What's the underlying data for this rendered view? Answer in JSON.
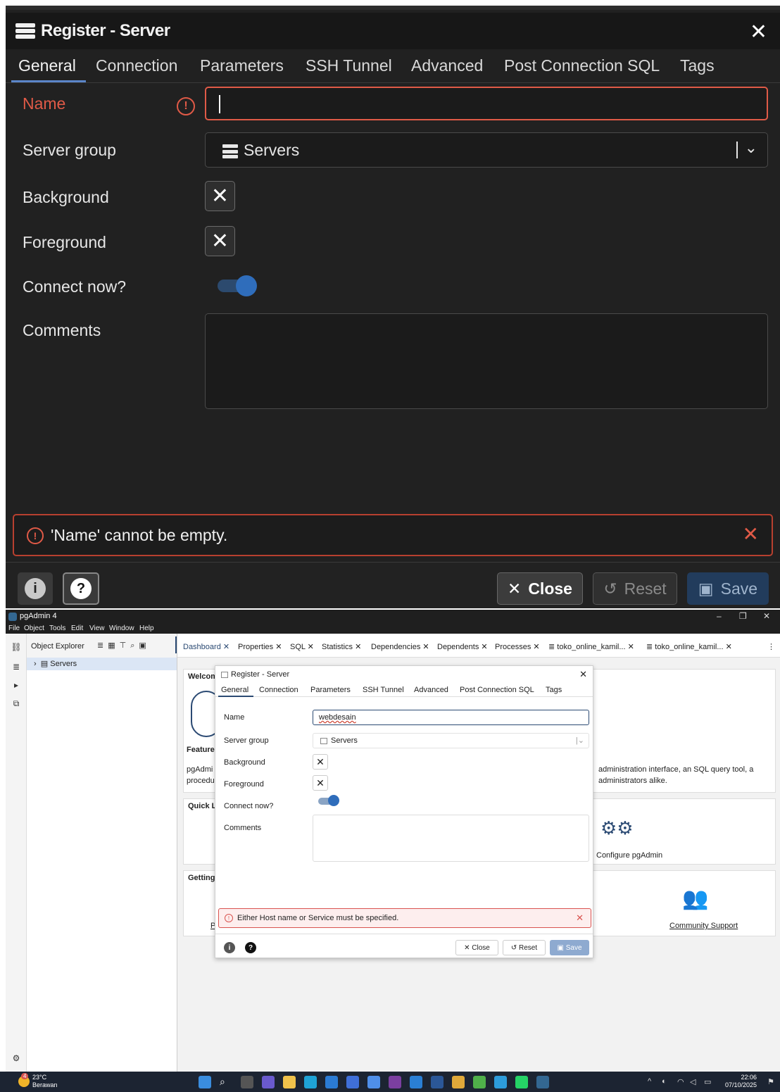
{
  "zoomed_dialog": {
    "title": "Register - Server",
    "close_glyph": "✕",
    "tabs": [
      "General",
      "Connection",
      "Parameters",
      "SSH Tunnel",
      "Advanced",
      "Post Connection SQL",
      "Tags"
    ],
    "active_tab": "General",
    "fields": {
      "name_label": "Name",
      "name_value": "",
      "server_group_label": "Server group",
      "server_group_value": "Servers",
      "background_label": "Background",
      "foreground_label": "Foreground",
      "connect_now_label": "Connect now?",
      "connect_now_on": true,
      "comments_label": "Comments",
      "comments_value": ""
    },
    "error_message": "'Name' cannot be empty.",
    "buttons": {
      "close": "Close",
      "reset": "Reset",
      "save": "Save",
      "info": "i",
      "help": "?"
    },
    "colors": {
      "error": "#e05a47",
      "accent": "#5b86c9",
      "toggle": "#2f6dbb"
    }
  },
  "window": {
    "app_title": "pgAdmin 4",
    "window_controls": [
      "–",
      "❐",
      "✕"
    ],
    "menu": [
      "File",
      "Object",
      "Tools",
      "Edit",
      "View",
      "Window",
      "Help"
    ],
    "object_explorer": {
      "title": "Object Explorer",
      "tree_item": "Servers"
    },
    "tabs": [
      {
        "label": "Dashboard"
      },
      {
        "label": "Properties"
      },
      {
        "label": "SQL"
      },
      {
        "label": "Statistics"
      },
      {
        "label": "Dependencies"
      },
      {
        "label": "Dependents"
      },
      {
        "label": "Processes"
      },
      {
        "label": "toko_online_kamil..."
      },
      {
        "label": "toko_online_kamil..."
      }
    ],
    "dashboard": {
      "welcome_partial": "Welcom",
      "feature_partial": "Feature",
      "body_line1_left": "pgAdmi",
      "body_line1_right": "administration interface, an SQL query tool, a",
      "body_line2_left": "procedu",
      "body_line2_right": "administrators alike.",
      "quick_links_partial": "Quick Li",
      "configure_label": "Configure pgAdmin",
      "getting_started_partial": "Getting !",
      "p_partial": "P",
      "community_label": "Community Support"
    },
    "dialog": {
      "title": "Register - Server",
      "tabs": [
        "General",
        "Connection",
        "Parameters",
        "SSH Tunnel",
        "Advanced",
        "Post Connection SQL",
        "Tags"
      ],
      "name_label": "Name",
      "name_value": "webdesain",
      "server_group_label": "Server group",
      "server_group_value": "Servers",
      "background_label": "Background",
      "foreground_label": "Foreground",
      "connect_now_label": "Connect now?",
      "comments_label": "Comments",
      "error_message": "Either Host name or Service must be specified.",
      "buttons": {
        "close": "Close",
        "reset": "Reset",
        "save": "Save"
      }
    }
  },
  "taskbar": {
    "weather_temp": "23°C",
    "weather_desc": "Berawan",
    "weather_badge": "4",
    "time": "22:06",
    "date": "07/10/2025"
  }
}
